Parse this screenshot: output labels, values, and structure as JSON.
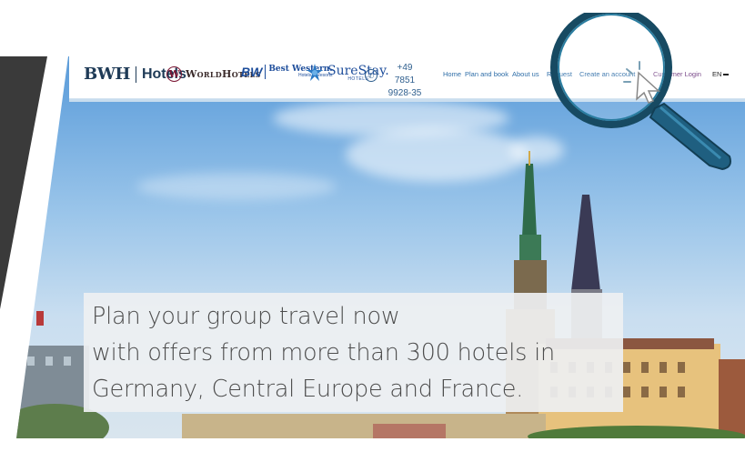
{
  "header": {
    "brands": {
      "bwh": "BWH",
      "bwh_hotels": "Hotels",
      "worldhotels": "WorldHotels",
      "worldhotels_mark": "W",
      "bestwestern_mark": "BW",
      "bestwestern": "Best Western.",
      "bestwestern_sub": "Hotels & Resorts",
      "surestay": "SureStay.",
      "surestay_sub": "HOTELS"
    },
    "phone": {
      "line1": "+49 7851",
      "line2": "9928-35",
      "icon": "phone-icon"
    },
    "nav": {
      "home": "Home",
      "plan_and_book": "Plan and book",
      "about_us": "About us",
      "request": "Request",
      "create_account": "Create an account",
      "customer_login": "Customer Login",
      "language": "EN"
    }
  },
  "hero": {
    "line1": "Plan your group travel now",
    "line2": "with offers from more than 300 hotels in",
    "line3": "Germany, Central Europe and France."
  },
  "overlay": {
    "icons": [
      "magnifier-icon",
      "pointer-cursor-icon"
    ],
    "accent": "#1f5c7a"
  }
}
